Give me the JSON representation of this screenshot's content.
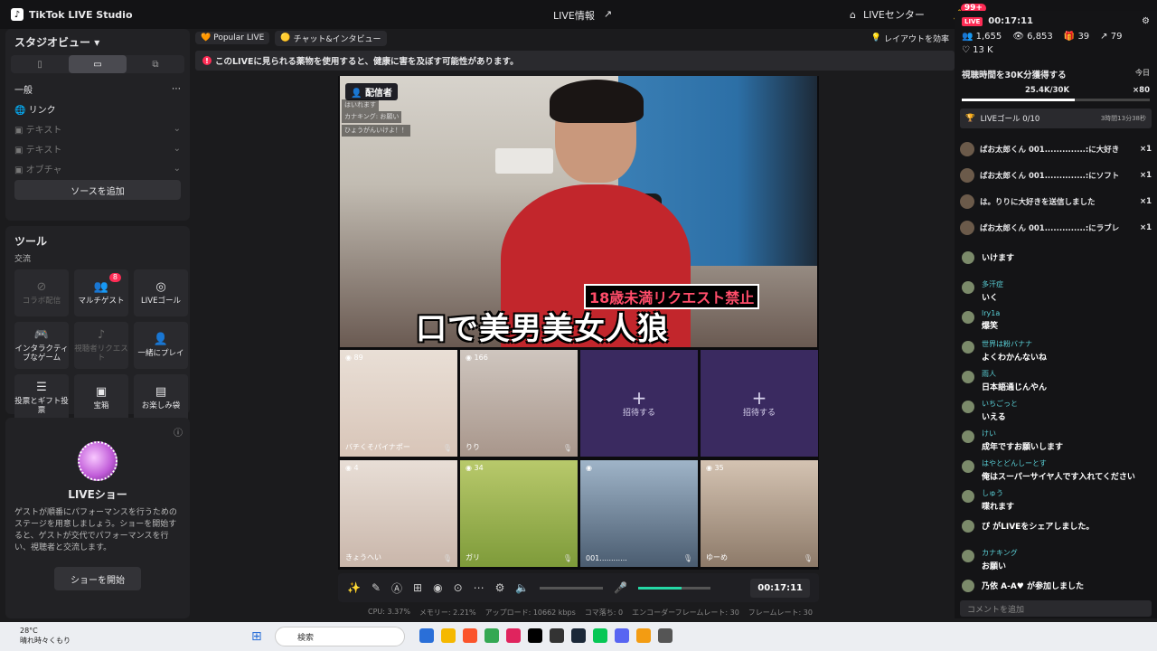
{
  "app": {
    "title": "TikTok LIVE Studio",
    "center_title": "LIVE情報",
    "live_center": "LIVEセンター",
    "notif_badge": "99+"
  },
  "left": {
    "studio_view": "スタジオビュー",
    "general": "一般",
    "link": "リンク",
    "sources": [
      "テキスト",
      "テキスト",
      "オブチャ"
    ],
    "add_source": "ソースを追加",
    "tools_title": "ツール",
    "exchange": "交流",
    "tools": [
      {
        "label": "コラボ配信",
        "dim": true
      },
      {
        "label": "マルチゲスト",
        "badge": "8"
      },
      {
        "label": "LIVEゴール"
      },
      {
        "label": "インタラクティブなゲーム"
      },
      {
        "label": "視聴者リクエスト",
        "dim": true
      },
      {
        "label": "一緒にプレイ"
      },
      {
        "label": "投票とギフト投票"
      },
      {
        "label": "宝箱"
      },
      {
        "label": "お楽しみ袋"
      }
    ],
    "show_title": "LIVEショー",
    "show_desc": "ゲストが順番にパフォーマンスを行うためのステージを用意しましょう。ショーを開始すると、ゲストが交代でパフォーマンスを行い、視聴者と交流します。",
    "show_button": "ショーを開始"
  },
  "topbar": {
    "popular": "Popular LIVE",
    "chat": "チャット&インタビュー",
    "layout": "レイアウトを効率"
  },
  "warning": "このLIVEに見られる薬物を使用すると、健康に害を及ぼす可能性があります。",
  "stage": {
    "host_tag": "配信者",
    "caption_top": "18歳未満リクエスト禁止",
    "caption_main": "口で美男美女人狼",
    "overlay": [
      "はいれます",
      "カナキング: お願い",
      "ひょうがんいけよ！！"
    ],
    "guests": [
      {
        "name": "バチくそパイナポー",
        "count": "89"
      },
      {
        "name": "りり",
        "count": "166"
      },
      {
        "name": "招待する",
        "invite": true
      },
      {
        "name": "招待する",
        "invite": true
      },
      {
        "name": "きょうへい",
        "count": "4"
      },
      {
        "name": "ガリ",
        "count": "34"
      },
      {
        "name": "001............",
        "count": ""
      },
      {
        "name": "ゆーめ",
        "count": "35"
      }
    ]
  },
  "controls": {
    "timer": "00:17:11"
  },
  "stats": {
    "cpu": "CPU: 3.37%",
    "mem": "メモリー: 2.21%",
    "upload": "アップロード: 10662 kbps",
    "drop": "コマ落ち: 0",
    "enc": "エンコーダーフレームレート: 30",
    "fps": "フレームレート: 30"
  },
  "right": {
    "live_tag": "LIVE",
    "timer": "00:17:11",
    "viewers": "1,655",
    "views": "6,853",
    "gifts": "39",
    "shares": "79",
    "likes": "13 K",
    "goal_title": "視聴時間を30K分獲得する",
    "goal_today": "今日",
    "goal_progress": "25.4K/30K",
    "goal_x": "×80",
    "live_goal": "LIVEゴール 0/10",
    "live_goal_time": "3時間13分38秒",
    "gifts_list": [
      {
        "user": "ぱお太郎くん 001..............:に大好き",
        "x": "×1"
      },
      {
        "user": "ぱお太郎くん 001..............:にソフト",
        "x": "×1"
      },
      {
        "user": "は。りりに大好きを送信しました",
        "x": "×1"
      },
      {
        "user": "ぱお太郎くん 001..............:にラブレ",
        "x": "×1"
      }
    ],
    "comments": [
      {
        "u": "",
        "t": "いけます"
      },
      {
        "u": "多汗症",
        "t": "いく"
      },
      {
        "u": "lry1a",
        "t": "爆笑"
      },
      {
        "u": "世界は粉バナナ",
        "t": "よくわかんないね"
      },
      {
        "u": "雨人",
        "t": "日本語通じんやん"
      },
      {
        "u": "いちごっと",
        "t": "いえる"
      },
      {
        "u": "けい",
        "t": "成年ですお願いします"
      },
      {
        "u": "はやとどんしーとす",
        "t": "俺はスーパーサイヤ人です入れてください"
      },
      {
        "u": "しゅう",
        "t": "喋れます"
      },
      {
        "u": "",
        "t": "ぴ がLIVEをシェアしました。"
      },
      {
        "u": "カナキング",
        "t": "お願い"
      },
      {
        "u": "",
        "t": "乃依 A-A♥ が参加しました"
      }
    ],
    "input": "コメントを追加"
  },
  "taskbar": {
    "temp": "28°C",
    "weather": "晴れ時々くもり",
    "search": "検索"
  }
}
